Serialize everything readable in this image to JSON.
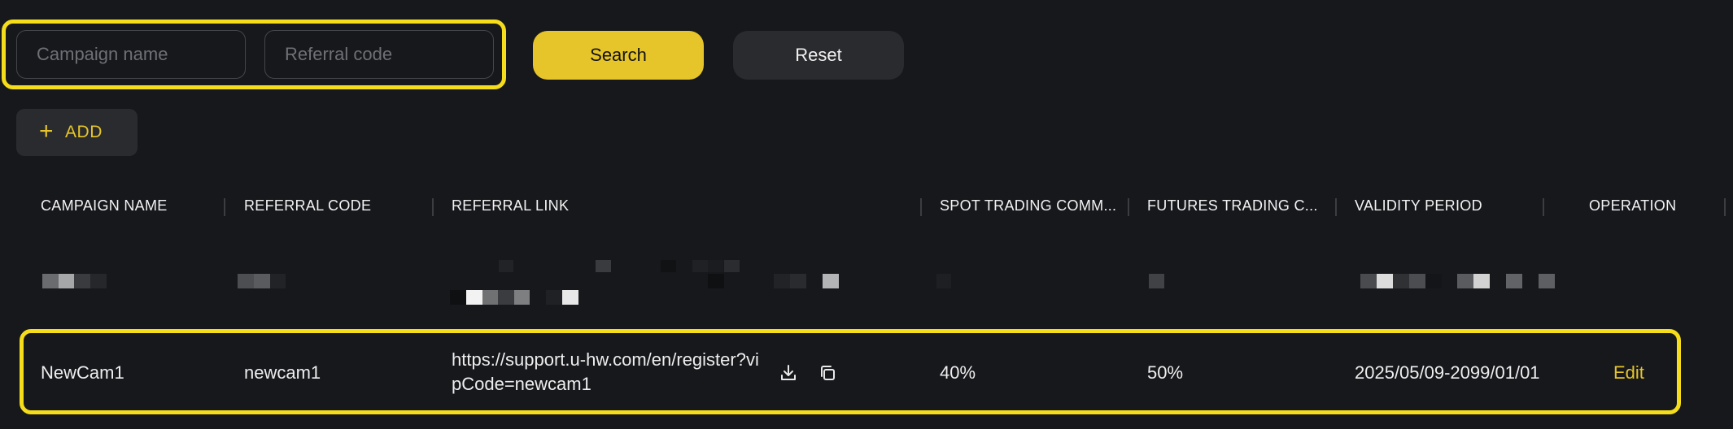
{
  "filters": {
    "campaign_placeholder": "Campaign name",
    "referral_placeholder": "Referral code",
    "search_label": "Search",
    "reset_label": "Reset"
  },
  "add_label": "ADD",
  "table": {
    "columns": [
      "CAMPAIGN NAME",
      "REFERRAL CODE",
      "REFERRAL LINK",
      "SPOT TRADING COMM...",
      "FUTURES TRADING C...",
      "VALIDITY PERIOD",
      "OPERATION"
    ],
    "rows": [
      {
        "campaign_name": "NewCam1",
        "referral_code": "newcam1",
        "referral_link": "https://support.u-hw.com/en/register?vipCode=newcam1",
        "spot_commission": "40%",
        "futures_commission": "50%",
        "validity_period": "2025/05/09-2099/01/01",
        "operation": "Edit"
      }
    ]
  },
  "colors": {
    "accent": "#e6c52a",
    "highlight": "#f5dd1b",
    "background": "#17181c"
  },
  "icons": {
    "download": "download-icon",
    "copy": "copy-icon"
  }
}
